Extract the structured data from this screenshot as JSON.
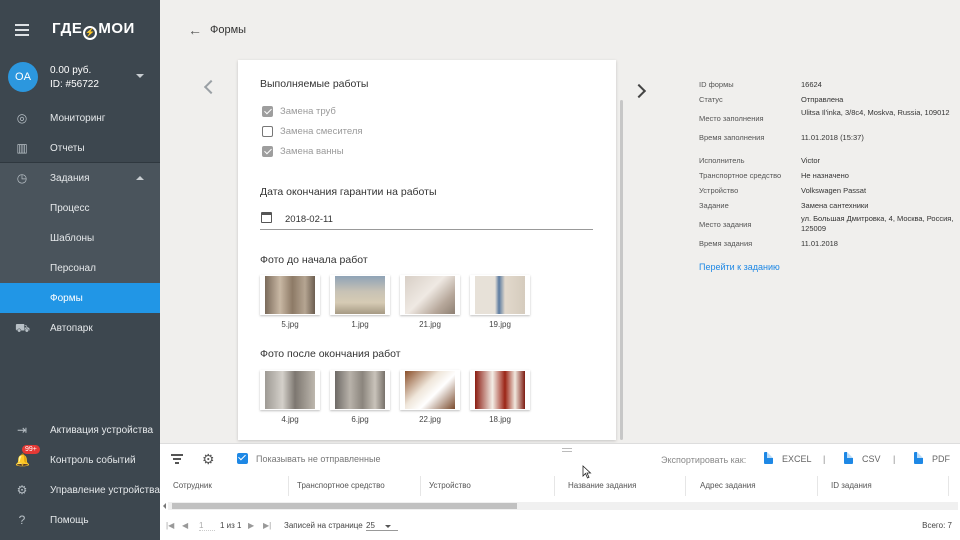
{
  "app": {
    "logo": "ГДЕ⚡МОИ"
  },
  "account": {
    "initials": "OA",
    "balance": "0.00 руб.",
    "id": "ID: #56722"
  },
  "sidebar": {
    "items": [
      {
        "label": "Мониторинг",
        "icon": "globe-icon"
      },
      {
        "label": "Отчеты",
        "icon": "bar-chart-icon"
      },
      {
        "label": "Задания",
        "icon": "clock-icon"
      },
      {
        "label": "Процесс"
      },
      {
        "label": "Шаблоны"
      },
      {
        "label": "Персонал"
      },
      {
        "label": "Формы"
      },
      {
        "label": "Автопарк",
        "icon": "car-icon"
      }
    ],
    "bottom_items": [
      {
        "label": "Активация устройства",
        "icon": "login-icon"
      },
      {
        "label": "Контроль событий",
        "icon": "bell-icon",
        "badge": "99+"
      },
      {
        "label": "Управление устройствами",
        "icon": "gear-icon"
      },
      {
        "label": "Помощь",
        "icon": "help-icon"
      }
    ]
  },
  "header": {
    "title": "Формы"
  },
  "card": {
    "works_title": "Выполняемые работы",
    "checks": [
      {
        "label": "Замена труб",
        "checked": true
      },
      {
        "label": "Замена смесителя",
        "checked": false
      },
      {
        "label": "Замена ванны",
        "checked": true
      }
    ],
    "warranty_title": "Дата окончания гарантии на работы",
    "warranty_date": "2018-02-11",
    "photos_before_title": "Фото до начала работ",
    "photos_before": [
      "5.jpg",
      "1.jpg",
      "21.jpg",
      "19.jpg"
    ],
    "photos_after_title": "Фото после окончания работ",
    "photos_after": [
      "4.jpg",
      "6.jpg",
      "22.jpg",
      "18.jpg"
    ]
  },
  "details": [
    {
      "label": "ID формы",
      "value": "16624"
    },
    {
      "label": "Статус",
      "value": "Отправлена"
    },
    {
      "label": "Место заполнения",
      "value": "Ulitsa Il'inka, 3/8c4, Moskva, Russia, 109012"
    },
    {
      "label": "Время заполнения",
      "value": "11.01.2018 (15:37)"
    },
    {
      "label": "Исполнитель",
      "value": "Victor"
    },
    {
      "label": "Транспортное средство",
      "value": "Не назначено"
    },
    {
      "label": "Устройство",
      "value": "Volkswagen Passat"
    },
    {
      "label": "Задание",
      "value": "Замена сантехники"
    },
    {
      "label": "Место задания",
      "value": "ул. Большая Дмитровка, 4, Москва, Россия, 125009"
    },
    {
      "label": "Время задания",
      "value": "11.01.2018"
    }
  ],
  "goto_link": "Перейти к заданию",
  "toolbar": {
    "show_unsent": "Показывать не отправленные",
    "export_label": "Экспортировать как:",
    "excel": "EXCEL",
    "csv": "CSV",
    "pdf": "PDF",
    "separator": "|"
  },
  "table": {
    "columns": [
      "Сотрудник",
      "Транспортное средство",
      "Устройство",
      "Название задания",
      "Адрес задания",
      "ID задания"
    ]
  },
  "pager": {
    "page": "1",
    "of": "1 из 1",
    "rows_label": "Записей на странице",
    "rows_value": "25",
    "total": "Всего: 7"
  },
  "colors": {
    "accent": "#2196e6",
    "sidebar": "#3d474f",
    "link": "#1e88e5"
  }
}
